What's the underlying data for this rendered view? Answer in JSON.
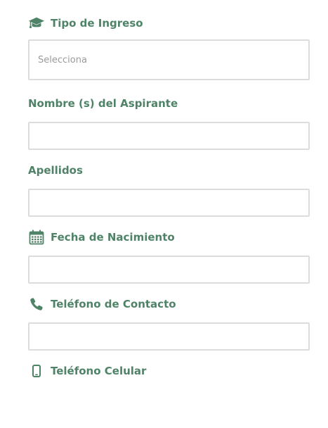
{
  "form": {
    "tipo_ingreso": {
      "label": "Tipo de Ingreso",
      "icon": "graduation-cap-icon",
      "placeholder": "Selecciona",
      "value": ""
    },
    "nombre": {
      "label": "Nombre (s) del Aspirante",
      "value": ""
    },
    "apellidos": {
      "label": "Apellidos",
      "value": ""
    },
    "fecha_nacimiento": {
      "label": "Fecha de Nacimiento",
      "icon": "calendar-icon",
      "value": ""
    },
    "telefono_contacto": {
      "label": "Teléfono de Contacto",
      "icon": "phone-icon",
      "value": ""
    },
    "telefono_celular": {
      "label": "Teléfono Celular",
      "icon": "mobile-phone-icon"
    }
  },
  "colors": {
    "label": "#4f8367",
    "border": "#dcdcdc",
    "placeholder": "#9a9a9a"
  }
}
